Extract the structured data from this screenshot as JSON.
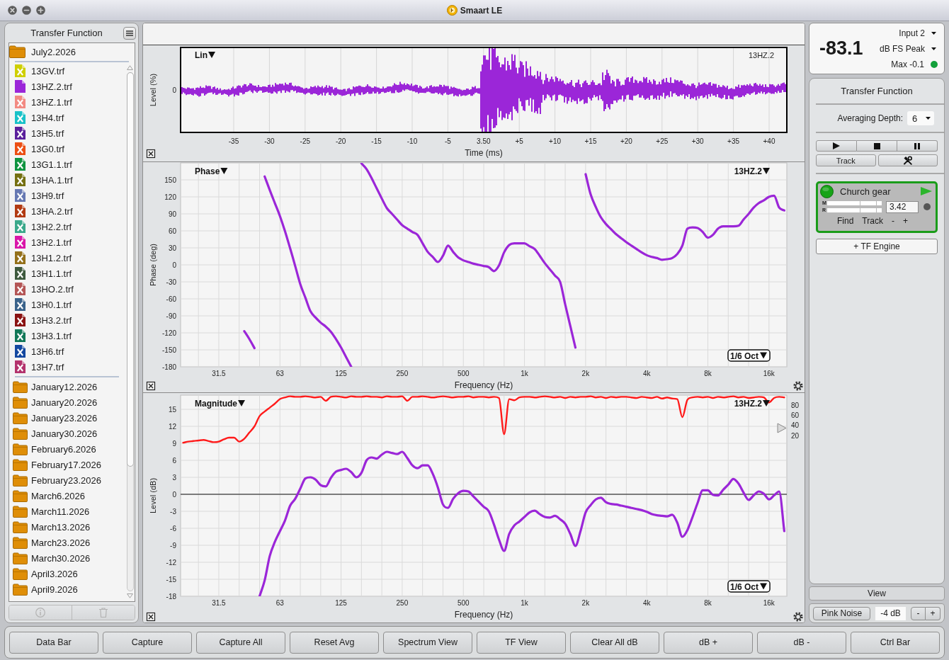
{
  "window": {
    "title": "Smaart LE"
  },
  "sidebar": {
    "title": "Transfer Function",
    "folder": "July2.2026",
    "files": [
      {
        "name": "13GV.trf",
        "color": "#cfcf00",
        "active": false
      },
      {
        "name": "13HZ.2.trf",
        "color": "#9b26d8",
        "active": true
      },
      {
        "name": "13HZ.1.trf",
        "color": "#f28a82",
        "active": false
      },
      {
        "name": "13H4.trf",
        "color": "#19c2c8",
        "active": false
      },
      {
        "name": "13H5.trf",
        "color": "#5b1f9c",
        "active": false
      },
      {
        "name": "13G0.trf",
        "color": "#ec4f14",
        "active": false
      },
      {
        "name": "13G1.1.trf",
        "color": "#0f9440",
        "active": false
      },
      {
        "name": "13HA.1.trf",
        "color": "#757012",
        "active": false
      },
      {
        "name": "13H9.trf",
        "color": "#6678b2",
        "active": false
      },
      {
        "name": "13HA.2.trf",
        "color": "#b23a12",
        "active": false
      },
      {
        "name": "13H2.2.trf",
        "color": "#3aa88a",
        "active": false
      },
      {
        "name": "13H2.1.trf",
        "color": "#d916a8",
        "active": false
      },
      {
        "name": "13H1.2.trf",
        "color": "#94701a",
        "active": false
      },
      {
        "name": "13H1.1.trf",
        "color": "#3e5a3e",
        "active": false
      },
      {
        "name": "13HO.2.trf",
        "color": "#b45656",
        "active": false
      },
      {
        "name": "13H0.1.trf",
        "color": "#3a628a",
        "active": false
      },
      {
        "name": "13H3.2.trf",
        "color": "#8a1212",
        "active": false
      },
      {
        "name": "13H3.1.trf",
        "color": "#137858",
        "active": false
      },
      {
        "name": "13H6.trf",
        "color": "#1448a0",
        "active": false
      },
      {
        "name": "13H7.trf",
        "color": "#b3326c",
        "active": false
      }
    ],
    "folders": [
      "January12.2026",
      "January20.2026",
      "January23.2026",
      "January30.2026",
      "February6.2026",
      "February17.2026",
      "February23.2026",
      "March6.2026",
      "March11.2026",
      "March13.2026",
      "March23.2026",
      "March30.2026",
      "April3.2026",
      "April9.2026"
    ],
    "actions": [
      {
        "kind": "info",
        "disabled": true
      },
      {
        "kind": "delete",
        "disabled": true
      }
    ]
  },
  "impulse_panel": {
    "mode": "Lin",
    "trace_label": "13HZ.2",
    "ylabel": "Level (%)",
    "ytick": "0",
    "xticks": [
      "-35",
      "-30",
      "-25",
      "-20",
      "-15",
      "-10",
      "-5",
      "3.50",
      "+5",
      "+10",
      "+15",
      "+20",
      "+25",
      "+30",
      "+35",
      "+40"
    ],
    "xlabel": "Time (ms)"
  },
  "phase_panel": {
    "view": "Phase",
    "smoothing": "1/6 Oct",
    "chart_data": {
      "type": "line",
      "xlabel": "Frequency (Hz)",
      "ylabel": "Phase (deg)",
      "grid": true,
      "categories": [
        null,
        null,
        null,
        null,
        null,
        null,
        null,
        "31.5",
        null,
        null,
        null,
        null,
        null,
        null,
        null,
        null,
        null,
        null,
        null,
        "63",
        null,
        null,
        null,
        null,
        null,
        null,
        null,
        null,
        null,
        null,
        null,
        "125",
        null,
        null,
        null,
        null,
        null,
        null,
        null,
        null,
        null,
        null,
        null,
        "250",
        null,
        null,
        null,
        null,
        null,
        null,
        null,
        null,
        null,
        null,
        null,
        "500",
        null,
        null,
        null,
        null,
        null,
        null,
        null,
        null,
        null,
        null,
        null,
        "1k",
        null,
        null,
        null,
        null,
        null,
        null,
        null,
        null,
        null,
        null,
        null,
        "2k",
        null,
        null,
        null,
        null,
        null,
        null,
        null,
        null,
        null,
        null,
        null,
        "4k",
        null,
        null,
        null,
        null,
        null,
        null,
        null,
        null,
        null,
        null,
        null,
        "8k",
        null,
        null,
        null,
        null,
        null,
        null,
        null,
        null,
        null,
        null,
        null,
        "16k",
        null,
        null,
        null
      ],
      "series": [
        {
          "name": "13HZ.2",
          "color": "#9b26d8",
          "values": [
            null,
            null,
            null,
            null,
            null,
            null,
            null,
            null,
            null,
            null,
            null,
            null,
            -117,
            -131,
            -147,
            null,
            156,
            132,
            109,
            86,
            59,
            29,
            -2,
            -34,
            -58,
            -82,
            -93,
            -102,
            -109,
            -118,
            -131,
            -146,
            -163,
            -180,
            null,
            179,
            169,
            153,
            135,
            117,
            100,
            90,
            80,
            70,
            64,
            58,
            53,
            38,
            23,
            14,
            5,
            16,
            34,
            23,
            13,
            8,
            5,
            2,
            0,
            -2,
            -4,
            -11,
            -1,
            22,
            35,
            38,
            38,
            38,
            33,
            28,
            16,
            3,
            -8,
            -19,
            -30,
            -70,
            -108,
            -146,
            null,
            160,
            124,
            102,
            84,
            72,
            63,
            54,
            47,
            40,
            34,
            28,
            22,
            17,
            14,
            12,
            9,
            10,
            12,
            19,
            34,
            64,
            66,
            65,
            58,
            48,
            53,
            64,
            68,
            68,
            68,
            69,
            80,
            90,
            101,
            109,
            114,
            120,
            122,
            101,
            96
          ]
        }
      ],
      "ylim": [
        -180,
        180
      ],
      "yticks": [
        150,
        120,
        90,
        60,
        30,
        0,
        -30,
        -60,
        -90,
        -120,
        -150,
        -180
      ]
    }
  },
  "magnitude_panel": {
    "view": "Magnitude",
    "smoothing": "1/6 Oct",
    "coherence_ticks": [
      "80",
      "60",
      "40",
      "20"
    ],
    "chart_data": {
      "type": "line",
      "xlabel": "Frequency (Hz)",
      "ylabel": "Level (dB)",
      "grid": true,
      "categories": [
        null,
        null,
        null,
        null,
        null,
        null,
        null,
        "31.5",
        null,
        null,
        null,
        null,
        null,
        null,
        null,
        null,
        null,
        null,
        null,
        "63",
        null,
        null,
        null,
        null,
        null,
        null,
        null,
        null,
        null,
        null,
        null,
        "125",
        null,
        null,
        null,
        null,
        null,
        null,
        null,
        null,
        null,
        null,
        null,
        "250",
        null,
        null,
        null,
        null,
        null,
        null,
        null,
        null,
        null,
        null,
        null,
        "500",
        null,
        null,
        null,
        null,
        null,
        null,
        null,
        null,
        null,
        null,
        null,
        "1k",
        null,
        null,
        null,
        null,
        null,
        null,
        null,
        null,
        null,
        null,
        null,
        "2k",
        null,
        null,
        null,
        null,
        null,
        null,
        null,
        null,
        null,
        null,
        null,
        "4k",
        null,
        null,
        null,
        null,
        null,
        null,
        null,
        null,
        null,
        null,
        null,
        "8k",
        null,
        null,
        null,
        null,
        null,
        null,
        null,
        null,
        null,
        null,
        null,
        "16k",
        null,
        null,
        null
      ],
      "series": [
        {
          "name": "13HZ.2",
          "color": "#9b26d8",
          "values": [
            null,
            null,
            null,
            null,
            null,
            null,
            null,
            null,
            null,
            null,
            null,
            null,
            null,
            null,
            null,
            -18,
            -15.2,
            -10.9,
            -8.4,
            -6.5,
            -4.6,
            -2,
            -0.8,
            1,
            2.8,
            3,
            2.6,
            1.6,
            1.4,
            2.9,
            4,
            4.3,
            4.5,
            3.9,
            3,
            3.8,
            6,
            6.5,
            6.3,
            7,
            7.5,
            7.3,
            7.1,
            7.5,
            6.4,
            5.1,
            4.6,
            5.1,
            5.1,
            3.6,
            1.2,
            -1.8,
            -2.4,
            -0.8,
            0.2,
            0.6,
            0.5,
            -0.4,
            -1.3,
            -2.2,
            -3,
            -5.3,
            -8,
            -10,
            -7,
            -5.5,
            -4.8,
            -4,
            -3.2,
            -2.9,
            -3.5,
            -4,
            -4.1,
            -3.8,
            -4.4,
            -5.2,
            -7,
            -9.1,
            -6.5,
            -3.2,
            -1.9,
            -0.9,
            -0.6,
            -1.4,
            -1.7,
            -1.8,
            -2,
            -2.2,
            -2.4,
            -2.6,
            -2.8,
            -3.1,
            -3.5,
            -3.7,
            -3.8,
            -3.9,
            -3.6,
            -5,
            -7.5,
            -6.3,
            -4,
            -1.5,
            0.7,
            0.7,
            -0.1,
            -0.2,
            0.8,
            1.7,
            2.7,
            1.9,
            0.3,
            -1,
            -0.2,
            0.5,
            0.1,
            -0.9,
            -0.2,
            0.5,
            -6.5
          ]
        },
        {
          "color": "#ff1a1a",
          "values": [
            9.1,
            9.3,
            9.4,
            9.5,
            9.6,
            9.4,
            9.2,
            9.3,
            9.7,
            10,
            10,
            9.3,
            9.8,
            10.9,
            12,
            13.8,
            14.6,
            15.3,
            16,
            16.8,
            17.1,
            17.3,
            17.2,
            17.2,
            17.3,
            17.2,
            17.1,
            17.2,
            16.5,
            17.2,
            17.3,
            17.2,
            17.1,
            17.3,
            17.2,
            17.2,
            17.3,
            17.2,
            17.2,
            17.1,
            17.3,
            17.2,
            17.2,
            17.3,
            16.5,
            17.2,
            17.2,
            17.3,
            17.2,
            17.1,
            17.2,
            17.3,
            17.2,
            17.1,
            17.2,
            17.2,
            17.3,
            17.1,
            17.2,
            17.2,
            17.1,
            17.2,
            17,
            10.6,
            16.8,
            16.6,
            17.1,
            17.2,
            17.2,
            17.1,
            17.2,
            17.3,
            17.2,
            17.1,
            17.2,
            17,
            17.2,
            17.1,
            17.2,
            17.2,
            17.3,
            17.1,
            17.2,
            17,
            17.2,
            17.1,
            17.2,
            17.2,
            17.1,
            17,
            17.2,
            17.1,
            17,
            17.2,
            16.9,
            17.1,
            16.9,
            16.8,
            13.6,
            16.7,
            17.1,
            17.2,
            17.1,
            17.2,
            17,
            17.2,
            17.1,
            17.2,
            17.3,
            17.1,
            17.2,
            17,
            17.1,
            17.2,
            17.1,
            16.2,
            17,
            17.2,
            17.1
          ]
        }
      ],
      "ylim": [
        -18,
        17.5
      ],
      "yticks": [
        15,
        12,
        9,
        6,
        3,
        0,
        -3,
        -6,
        -9,
        -12,
        -15,
        -18
      ]
    }
  },
  "meter": {
    "value": "-83.1",
    "input": "Input 2",
    "scale": "dB FS Peak",
    "max": "Max -0.1"
  },
  "tf_panel": {
    "title": "Transfer Function",
    "averaging_label": "Averaging Depth:",
    "averaging_value": "6",
    "track": "Track",
    "engine": {
      "name": "Church gear",
      "on": true,
      "meters": [
        {
          "label": "M"
        },
        {
          "label": "R"
        }
      ],
      "delay": "3.42",
      "buttons": [
        "Find",
        "Track",
        "-",
        "+"
      ]
    },
    "add_engine": "+ TF Engine"
  },
  "view_button": "View",
  "generator": {
    "label": "Pink Noise",
    "gain": "-4 dB",
    "buttons": [
      "-",
      "+"
    ]
  },
  "bottom_bar": [
    "Data Bar",
    "Capture",
    "Capture All",
    "Reset Avg",
    "Spectrum View",
    "TF View",
    "Clear All dB",
    "dB +",
    "dB -",
    "Ctrl Bar"
  ]
}
